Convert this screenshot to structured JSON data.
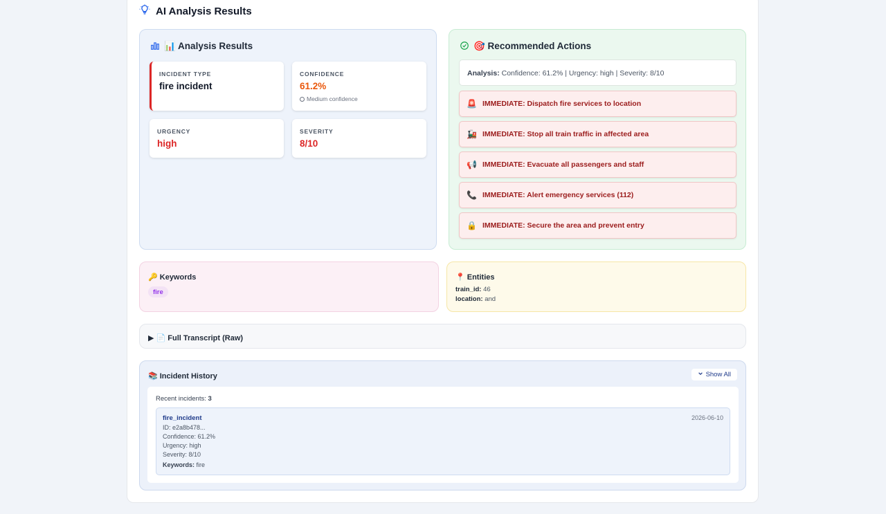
{
  "header": {
    "title": "AI Analysis Results"
  },
  "analysis": {
    "title": "📊 Analysis Results",
    "incident_type": {
      "label": "INCIDENT TYPE",
      "value": "fire incident"
    },
    "confidence": {
      "label": "CONFIDENCE",
      "value": "61.2%",
      "sub": "Medium confidence"
    },
    "urgency": {
      "label": "URGENCY",
      "value": "high"
    },
    "severity": {
      "label": "SEVERITY",
      "value": "8/10"
    },
    "colors": {
      "danger": "#dc2626",
      "warning": "#ea580c"
    }
  },
  "actions": {
    "title": "🎯 Recommended Actions",
    "summary_label": "Analysis:",
    "summary_text": "Confidence: 61.2% | Urgency: high | Severity: 8/10",
    "items": [
      {
        "icon": "🚨",
        "text": "IMMEDIATE: Dispatch fire services to location"
      },
      {
        "icon": "🚂",
        "text": "IMMEDIATE: Stop all train traffic in affected area"
      },
      {
        "icon": "📢",
        "text": "IMMEDIATE: Evacuate all passengers and staff"
      },
      {
        "icon": "📞",
        "text": "IMMEDIATE: Alert emergency services (112)"
      },
      {
        "icon": "🔒",
        "text": "IMMEDIATE: Secure the area and prevent entry"
      }
    ]
  },
  "keywords": {
    "title": "🔑 Keywords",
    "items": [
      "fire"
    ]
  },
  "entities": {
    "title": "📍 Entities",
    "items": [
      {
        "key": "train_id:",
        "value": "46"
      },
      {
        "key": "location:",
        "value": "and"
      }
    ]
  },
  "transcript": {
    "title": "▶ 📄 Full Transcript (Raw)"
  },
  "history": {
    "title": "📚 Incident History",
    "show_all": "Show All",
    "recent_label": "Recent incidents:",
    "recent_count": "3",
    "entry": {
      "type": "fire_incident",
      "date": "2026-06-10",
      "id": "ID: e2a8b478...",
      "confidence": "Confidence: 61.2%",
      "urgency": "Urgency: high",
      "severity": "Severity: 8/10",
      "keywords_label": "Keywords:",
      "keywords_value": "fire"
    }
  }
}
